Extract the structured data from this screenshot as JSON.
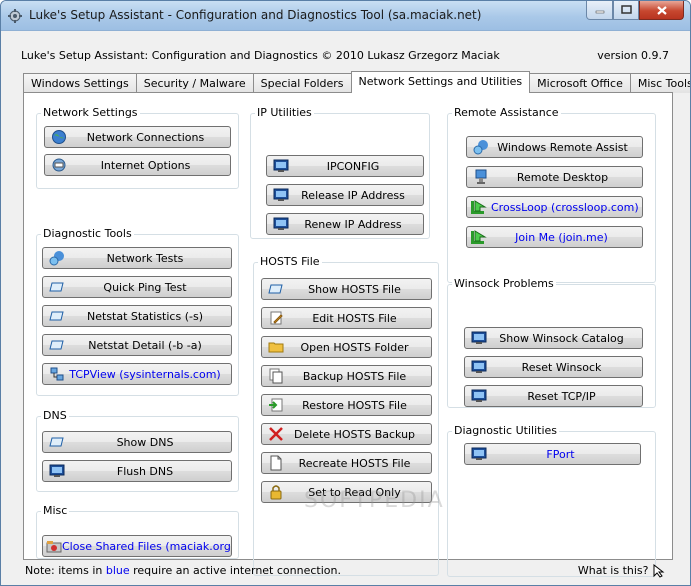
{
  "window": {
    "title": "Luke's Setup Assistant - Configuration and Diagnostics Tool (sa.maciak.net)"
  },
  "header": {
    "app_line": "Luke's Setup Assistant: Configuration and Diagnostics © 2010 Lukasz Grzegorz Maciak",
    "version": "version 0.9.7"
  },
  "tabs": [
    {
      "label": "Windows Settings"
    },
    {
      "label": "Security / Malware"
    },
    {
      "label": "Special Folders"
    },
    {
      "label": "Network Settings and Utilities",
      "active": true
    },
    {
      "label": "Microsoft Office"
    },
    {
      "label": "Misc Tools and Links"
    }
  ],
  "groups": {
    "network_settings": {
      "label": "Network Settings",
      "buttons": [
        "Network Connections",
        "Internet Options"
      ]
    },
    "diagnostic_tools": {
      "label": "Diagnostic Tools",
      "buttons": [
        "Network Tests",
        "Quick Ping Test",
        "Netstat Statistics (-s)",
        "Netstat Detail (-b -a)",
        "TCPView (sysinternals.com)"
      ]
    },
    "dns": {
      "label": "DNS",
      "buttons": [
        "Show DNS",
        "Flush DNS"
      ]
    },
    "misc": {
      "label": "Misc",
      "buttons": [
        "Close Shared Files (maciak.org)"
      ]
    },
    "ip_utilities": {
      "label": "IP Utilities",
      "buttons": [
        "IPCONFIG",
        "Release IP Address",
        "Renew IP Address"
      ]
    },
    "hosts_file": {
      "label": "HOSTS File",
      "buttons": [
        "Show HOSTS File",
        "Edit HOSTS File",
        "Open HOSTS Folder",
        "Backup HOSTS File",
        "Restore HOSTS File",
        "Delete HOSTS Backup",
        "Recreate HOSTS File",
        "Set to Read Only"
      ]
    },
    "remote_assistance": {
      "label": "Remote Assistance",
      "buttons": [
        "Windows Remote Assist",
        "Remote Desktop",
        "CrossLoop (crossloop.com)",
        "Join Me (join.me)"
      ]
    },
    "winsock_problems": {
      "label": "Winsock Problems",
      "buttons": [
        "Show Winsock Catalog",
        "Reset Winsock",
        "Reset TCP/IP"
      ]
    },
    "diagnostic_utilities": {
      "label": "Diagnostic Utilities",
      "buttons": [
        "FPort"
      ]
    }
  },
  "status": {
    "note_prefix": "Note: items in ",
    "note_blue": "blue",
    "note_suffix": " require an active internet connection.",
    "help_link": "What is this?"
  },
  "watermark": "SOFTPEDIA",
  "colors": {
    "link_blue": "#0000ee",
    "title_gradient": "#a9c8e8"
  }
}
